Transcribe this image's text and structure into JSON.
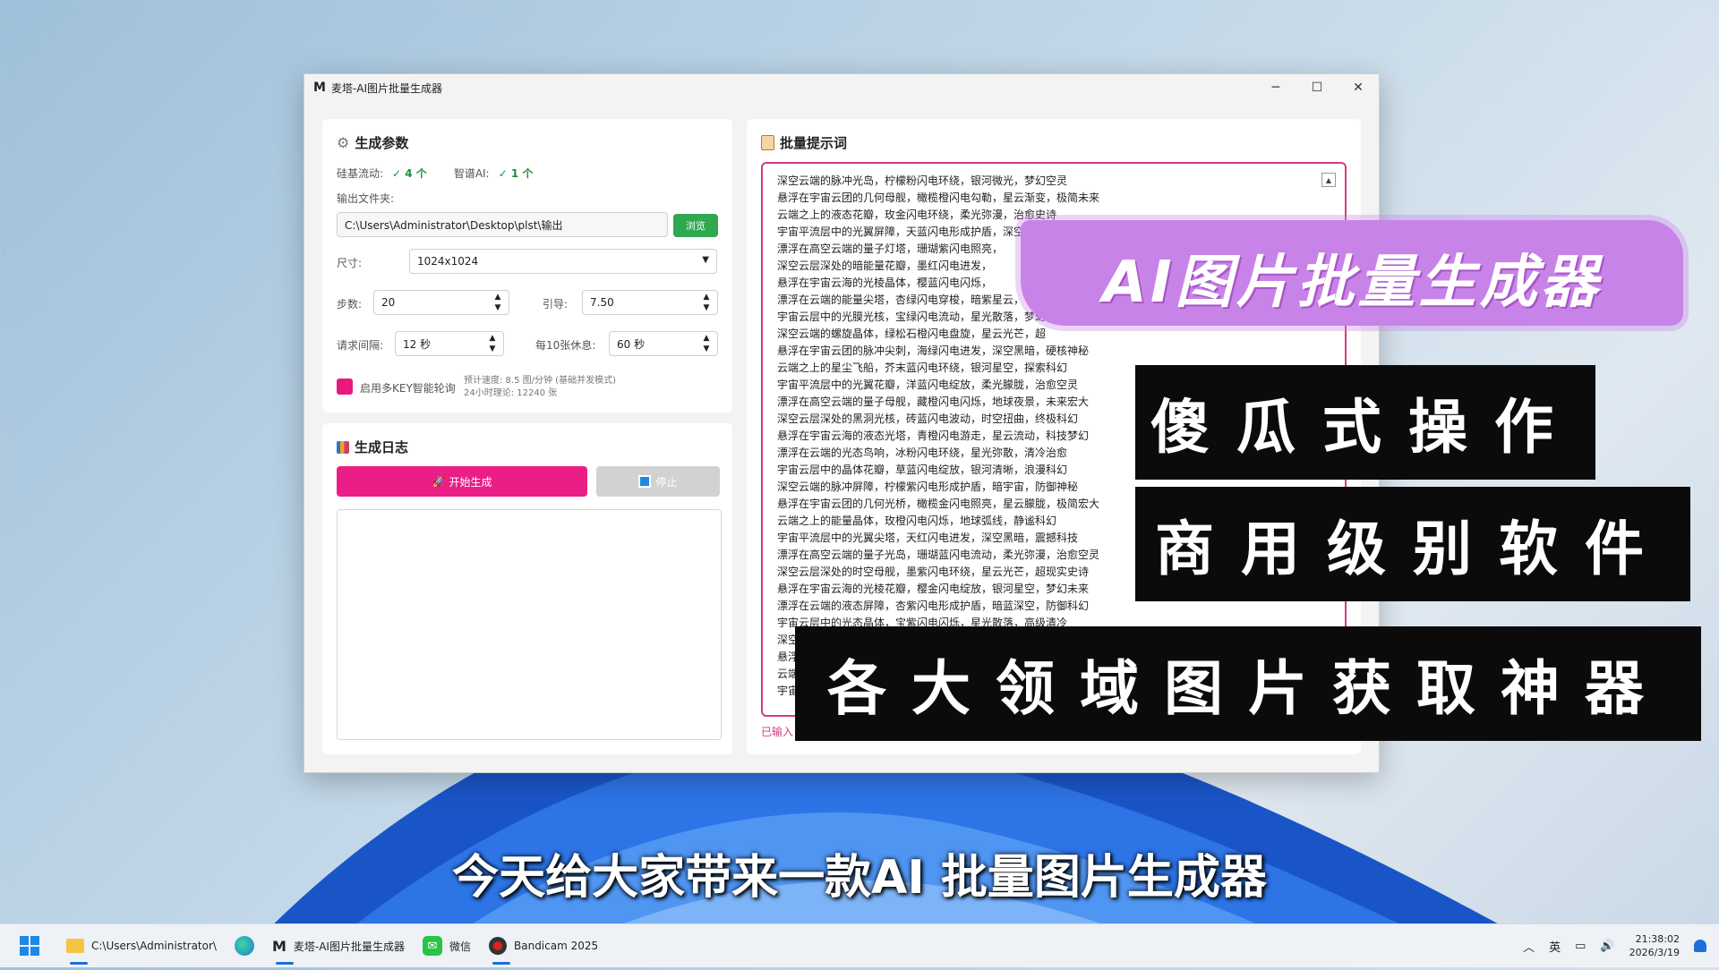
{
  "window": {
    "logo": "M",
    "title": "麦塔-AI图片批量生成器",
    "minimize": "─",
    "maximize": "☐",
    "close": "✕"
  },
  "params": {
    "title": "生成参数",
    "silicon_label": "硅基流动:",
    "silicon_value": "✓ 4 个",
    "zhipu_label": "智谱AI:",
    "zhipu_value": "✓ 1 个",
    "output_label": "输出文件夹:",
    "output_path": "C:\\Users\\Administrator\\Desktop\\plst\\输出",
    "browse": "浏览",
    "size_label": "尺寸:",
    "size_value": "1024x1024",
    "steps_label": "步数:",
    "steps_value": "20",
    "guidance_label": "引导:",
    "guidance_value": "7.50",
    "interval_label": "请求间隔:",
    "interval_value": "12 秒",
    "rest_label": "每10张休息:",
    "rest_value": "60 秒",
    "multikey_label": "启用多KEY智能轮询",
    "speed_note": "预计速度: 8.5 图/分钟 (基础并发模式)",
    "daily_note": "24小时理论: 12240 张"
  },
  "log": {
    "title": "生成日志",
    "start": "开始生成",
    "stop": "停止"
  },
  "prompts": {
    "title": "批量提示词",
    "lines": [
      "深空云端的脉冲光岛，柠檬粉闪电环绕，银河微光，梦幻空灵",
      "悬浮在宇宙云团的几何母舰，橄榄橙闪电勾勒，星云渐变，极简未来",
      "云端之上的液态花瓣，玫金闪电环绕，柔光弥漫，治愈史诗",
      "宇宙平流层中的光翼屏障，天蓝闪电形成护盾，深空黑暗，防御科技",
      "漂浮在高空云端的量子灯塔，珊瑚紫闪电照亮，",
      "深空云层深处的暗能量花瓣，墨红闪电进发，",
      "悬浮在宇宙云海的光棱晶体，樱蓝闪电闪烁，",
      "漂浮在云端的能量尖塔，杏绿闪电穿梭，暗紫星云，",
      "宇宙云层中的光膜光核，宝绿闪电流动，星光散落，梦幻",
      "深空云端的螺旋晶体，绿松石橙闪电盘旋，星云光芒，超",
      "悬浮在宇宙云团的脉冲尖刺，海绿闪电进发，深空黑暗，硬核神秘",
      "云端之上的星尘飞船，芥末蓝闪电环绕，银河星空，探索科幻",
      "宇宙平流层中的光翼花瓣，洋蓝闪电绽放，柔光朦胧，治愈空灵",
      "漂浮在高空云端的量子母舰，藏橙闪电闪烁，地球夜景，未来宏大",
      "深空云层深处的黑洞光核，砖蓝闪电波动，时空扭曲，终极科幻",
      "悬浮在宇宙云海的液态光塔，青橙闪电游走，星云流动，科技梦幻",
      "漂浮在云端的光态鸟响，冰粉闪电环绕，星光弥散，清冷治愈",
      "宇宙云层中的晶体花瓣，草蓝闪电绽放，银河清晰，浪漫科幻",
      "深空云端的脉冲屏障，柠檬紫闪电形成护盾，暗宇宙，防御神秘",
      "悬浮在宇宙云团的几何光桥，橄榄金闪电照亮，星云朦胧，极简宏大",
      "云端之上的能量晶体，玫橙闪电闪烁，地球弧线，静谧科幻",
      "宇宙平流层中的光翼尖塔，天红闪电进发，深空黑暗，震撼科技",
      "漂浮在高空云端的量子光岛，珊瑚蓝闪电流动，柔光弥漫，治愈空灵",
      "深空云层深处的时空母舰，墨紫闪电环绕，星云光芒，超现实史诗",
      "悬浮在宇宙云海的光棱花瓣，樱金闪电绽放，银河星空，梦幻未来",
      "漂浮在云端的液态屏障，杏紫闪电形成护盾，暗蓝深空，防御科幻",
      "宇宙云层中的光态晶体，宝紫闪电闪烁，星光散落，高级清冷",
      "深空",
      "悬浮",
      "云端",
      "宇宙"
    ],
    "count_label": "已输入"
  },
  "promo": {
    "headline": "AI图片批量生成器",
    "line1": "傻瓜式操作",
    "line2": "商用级别软件",
    "line3": "各大领域图片获取神器",
    "subtitle": "今天给大家带来一款AI 批量图片生成器"
  },
  "taskbar": {
    "explorer": "C:\\Users\\Administrator\\",
    "app": "麦塔-AI图片批量生成器",
    "wechat": "微信",
    "bandicam": "Bandicam 2025",
    "ime": "英",
    "time": "21:38:02",
    "date": "2026/3/19"
  },
  "colors": {
    "accent_pink": "#ea1e86",
    "browse_green": "#2fa84f",
    "promo_purple": "#c883e8"
  }
}
